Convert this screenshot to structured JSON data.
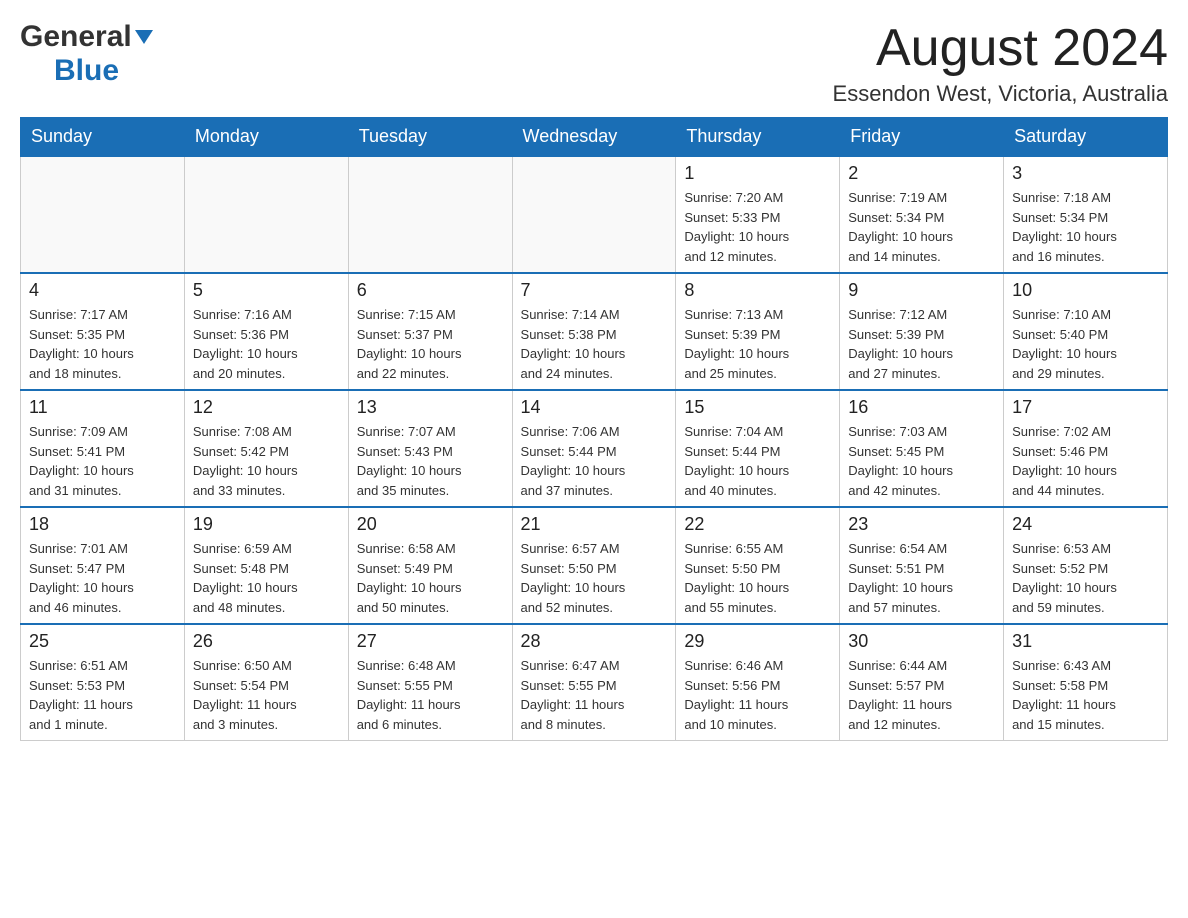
{
  "header": {
    "logo_general": "General",
    "logo_blue": "Blue",
    "title": "August 2024",
    "subtitle": "Essendon West, Victoria, Australia"
  },
  "days_of_week": [
    "Sunday",
    "Monday",
    "Tuesday",
    "Wednesday",
    "Thursday",
    "Friday",
    "Saturday"
  ],
  "weeks": [
    [
      {
        "day": "",
        "info": ""
      },
      {
        "day": "",
        "info": ""
      },
      {
        "day": "",
        "info": ""
      },
      {
        "day": "",
        "info": ""
      },
      {
        "day": "1",
        "info": "Sunrise: 7:20 AM\nSunset: 5:33 PM\nDaylight: 10 hours\nand 12 minutes."
      },
      {
        "day": "2",
        "info": "Sunrise: 7:19 AM\nSunset: 5:34 PM\nDaylight: 10 hours\nand 14 minutes."
      },
      {
        "day": "3",
        "info": "Sunrise: 7:18 AM\nSunset: 5:34 PM\nDaylight: 10 hours\nand 16 minutes."
      }
    ],
    [
      {
        "day": "4",
        "info": "Sunrise: 7:17 AM\nSunset: 5:35 PM\nDaylight: 10 hours\nand 18 minutes."
      },
      {
        "day": "5",
        "info": "Sunrise: 7:16 AM\nSunset: 5:36 PM\nDaylight: 10 hours\nand 20 minutes."
      },
      {
        "day": "6",
        "info": "Sunrise: 7:15 AM\nSunset: 5:37 PM\nDaylight: 10 hours\nand 22 minutes."
      },
      {
        "day": "7",
        "info": "Sunrise: 7:14 AM\nSunset: 5:38 PM\nDaylight: 10 hours\nand 24 minutes."
      },
      {
        "day": "8",
        "info": "Sunrise: 7:13 AM\nSunset: 5:39 PM\nDaylight: 10 hours\nand 25 minutes."
      },
      {
        "day": "9",
        "info": "Sunrise: 7:12 AM\nSunset: 5:39 PM\nDaylight: 10 hours\nand 27 minutes."
      },
      {
        "day": "10",
        "info": "Sunrise: 7:10 AM\nSunset: 5:40 PM\nDaylight: 10 hours\nand 29 minutes."
      }
    ],
    [
      {
        "day": "11",
        "info": "Sunrise: 7:09 AM\nSunset: 5:41 PM\nDaylight: 10 hours\nand 31 minutes."
      },
      {
        "day": "12",
        "info": "Sunrise: 7:08 AM\nSunset: 5:42 PM\nDaylight: 10 hours\nand 33 minutes."
      },
      {
        "day": "13",
        "info": "Sunrise: 7:07 AM\nSunset: 5:43 PM\nDaylight: 10 hours\nand 35 minutes."
      },
      {
        "day": "14",
        "info": "Sunrise: 7:06 AM\nSunset: 5:44 PM\nDaylight: 10 hours\nand 37 minutes."
      },
      {
        "day": "15",
        "info": "Sunrise: 7:04 AM\nSunset: 5:44 PM\nDaylight: 10 hours\nand 40 minutes."
      },
      {
        "day": "16",
        "info": "Sunrise: 7:03 AM\nSunset: 5:45 PM\nDaylight: 10 hours\nand 42 minutes."
      },
      {
        "day": "17",
        "info": "Sunrise: 7:02 AM\nSunset: 5:46 PM\nDaylight: 10 hours\nand 44 minutes."
      }
    ],
    [
      {
        "day": "18",
        "info": "Sunrise: 7:01 AM\nSunset: 5:47 PM\nDaylight: 10 hours\nand 46 minutes."
      },
      {
        "day": "19",
        "info": "Sunrise: 6:59 AM\nSunset: 5:48 PM\nDaylight: 10 hours\nand 48 minutes."
      },
      {
        "day": "20",
        "info": "Sunrise: 6:58 AM\nSunset: 5:49 PM\nDaylight: 10 hours\nand 50 minutes."
      },
      {
        "day": "21",
        "info": "Sunrise: 6:57 AM\nSunset: 5:50 PM\nDaylight: 10 hours\nand 52 minutes."
      },
      {
        "day": "22",
        "info": "Sunrise: 6:55 AM\nSunset: 5:50 PM\nDaylight: 10 hours\nand 55 minutes."
      },
      {
        "day": "23",
        "info": "Sunrise: 6:54 AM\nSunset: 5:51 PM\nDaylight: 10 hours\nand 57 minutes."
      },
      {
        "day": "24",
        "info": "Sunrise: 6:53 AM\nSunset: 5:52 PM\nDaylight: 10 hours\nand 59 minutes."
      }
    ],
    [
      {
        "day": "25",
        "info": "Sunrise: 6:51 AM\nSunset: 5:53 PM\nDaylight: 11 hours\nand 1 minute."
      },
      {
        "day": "26",
        "info": "Sunrise: 6:50 AM\nSunset: 5:54 PM\nDaylight: 11 hours\nand 3 minutes."
      },
      {
        "day": "27",
        "info": "Sunrise: 6:48 AM\nSunset: 5:55 PM\nDaylight: 11 hours\nand 6 minutes."
      },
      {
        "day": "28",
        "info": "Sunrise: 6:47 AM\nSunset: 5:55 PM\nDaylight: 11 hours\nand 8 minutes."
      },
      {
        "day": "29",
        "info": "Sunrise: 6:46 AM\nSunset: 5:56 PM\nDaylight: 11 hours\nand 10 minutes."
      },
      {
        "day": "30",
        "info": "Sunrise: 6:44 AM\nSunset: 5:57 PM\nDaylight: 11 hours\nand 12 minutes."
      },
      {
        "day": "31",
        "info": "Sunrise: 6:43 AM\nSunset: 5:58 PM\nDaylight: 11 hours\nand 15 minutes."
      }
    ]
  ]
}
